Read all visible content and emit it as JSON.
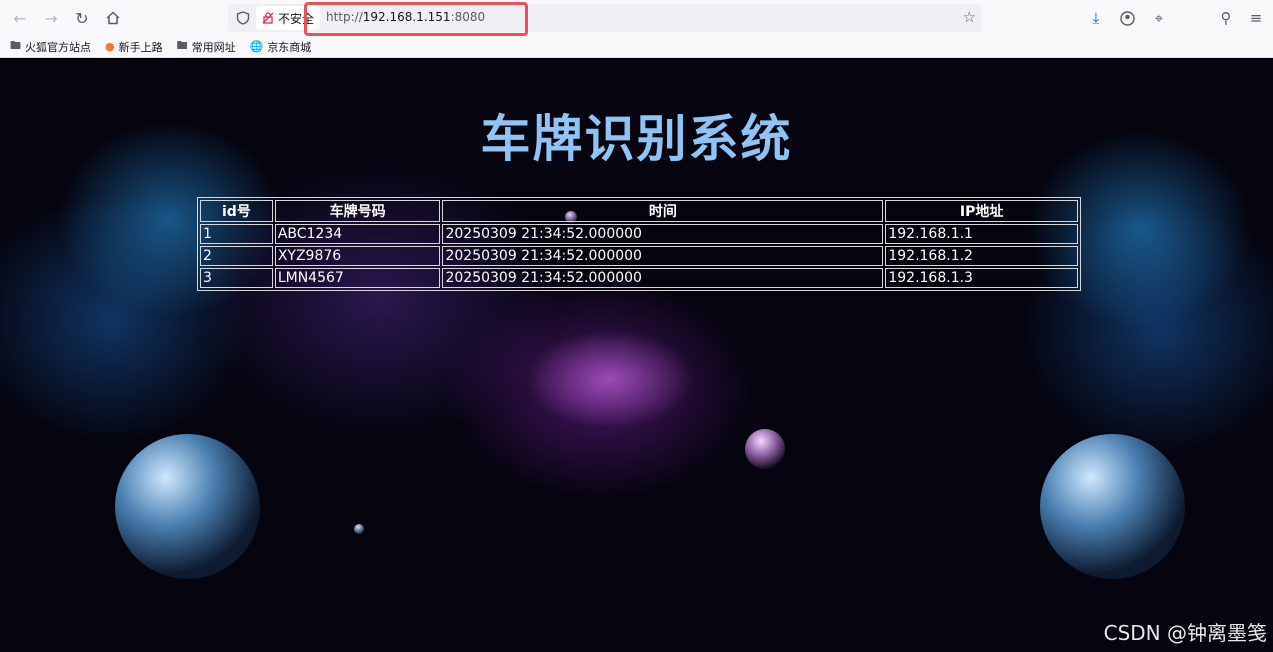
{
  "browser": {
    "url_scheme": "http://",
    "url_host": "192.168.1.151",
    "url_port": ":8080",
    "security_label": "不安全",
    "bookmarks": [
      {
        "label": "火狐官方站点",
        "icon": "folder-icon"
      },
      {
        "label": "新手上路",
        "icon": "firefox-icon"
      },
      {
        "label": "常用网址",
        "icon": "folder-icon"
      },
      {
        "label": "京东商城",
        "icon": "globe-icon"
      }
    ]
  },
  "page": {
    "title": "车牌识别系统",
    "table": {
      "headers": [
        "id号",
        "车牌号码",
        "时间",
        "IP地址"
      ],
      "rows": [
        [
          "1",
          "ABC1234",
          "20250309 21:34:52.000000",
          "192.168.1.1"
        ],
        [
          "2",
          "XYZ9876",
          "20250309 21:34:52.000000",
          "192.168.1.2"
        ],
        [
          "3",
          "LMN4567",
          "20250309 21:34:52.000000",
          "192.168.1.3"
        ]
      ]
    },
    "watermark": "CSDN @钟离墨笺"
  },
  "colors": {
    "title": "#8fc5f5",
    "highlight_box": "#e8505b",
    "insecure_icon": "#e22850",
    "download_icon": "#0060df"
  }
}
